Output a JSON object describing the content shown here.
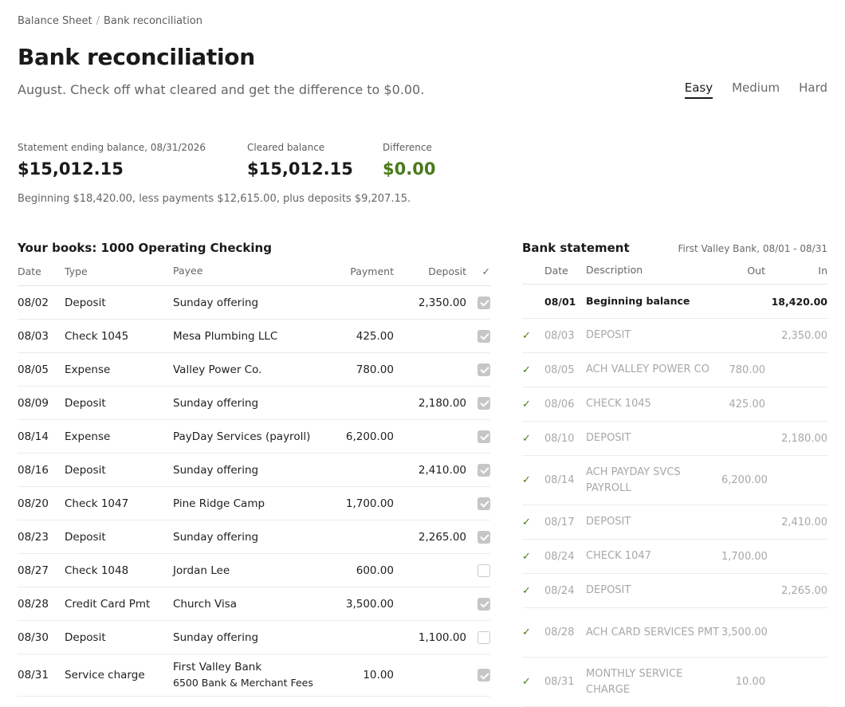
{
  "breadcrumb": {
    "parent": "Balance Sheet",
    "separator": "/",
    "current": "Bank reconciliation"
  },
  "page": {
    "title": "Bank reconciliation",
    "subtitle": "August. Check off what cleared and get the difference to $0.00."
  },
  "difficulty": {
    "options": [
      "Easy",
      "Medium",
      "Hard"
    ],
    "selected": "Easy"
  },
  "summary": {
    "statement_label": "Statement ending balance, 08/31/2026",
    "statement_value": "$15,012.15",
    "cleared_label": "Cleared balance",
    "cleared_value": "$15,012.15",
    "difference_label": "Difference",
    "difference_value": "$0.00",
    "difference_color": "#4a7a1a",
    "note": "Beginning $18,420.00, less payments $12,615.00, plus deposits $9,207.15."
  },
  "books": {
    "title": "Your books: 1000 Operating Checking",
    "columns": {
      "date": "Date",
      "type": "Type",
      "payee": "Payee",
      "payment": "Payment",
      "deposit": "Deposit",
      "cleared": "✓"
    },
    "rows": [
      {
        "date": "08/02",
        "type": "Deposit",
        "payee": "Sunday offering",
        "payee_sub": "",
        "payment": "",
        "deposit": "2,350.00",
        "cleared": true
      },
      {
        "date": "08/03",
        "type": "Check 1045",
        "payee": "Mesa Plumbing LLC",
        "payee_sub": "",
        "payment": "425.00",
        "deposit": "",
        "cleared": true
      },
      {
        "date": "08/05",
        "type": "Expense",
        "payee": "Valley Power Co.",
        "payee_sub": "",
        "payment": "780.00",
        "deposit": "",
        "cleared": true
      },
      {
        "date": "08/09",
        "type": "Deposit",
        "payee": "Sunday offering",
        "payee_sub": "",
        "payment": "",
        "deposit": "2,180.00",
        "cleared": true
      },
      {
        "date": "08/14",
        "type": "Expense",
        "payee": "PayDay Services (payroll)",
        "payee_sub": "",
        "payment": "6,200.00",
        "deposit": "",
        "cleared": true
      },
      {
        "date": "08/16",
        "type": "Deposit",
        "payee": "Sunday offering",
        "payee_sub": "",
        "payment": "",
        "deposit": "2,410.00",
        "cleared": true
      },
      {
        "date": "08/20",
        "type": "Check 1047",
        "payee": "Pine Ridge Camp",
        "payee_sub": "",
        "payment": "1,700.00",
        "deposit": "",
        "cleared": true
      },
      {
        "date": "08/23",
        "type": "Deposit",
        "payee": "Sunday offering",
        "payee_sub": "",
        "payment": "",
        "deposit": "2,265.00",
        "cleared": true
      },
      {
        "date": "08/27",
        "type": "Check 1048",
        "payee": "Jordan Lee",
        "payee_sub": "",
        "payment": "600.00",
        "deposit": "",
        "cleared": false
      },
      {
        "date": "08/28",
        "type": "Credit Card Pmt",
        "payee": "Church Visa",
        "payee_sub": "",
        "payment": "3,500.00",
        "deposit": "",
        "cleared": true
      },
      {
        "date": "08/30",
        "type": "Deposit",
        "payee": "Sunday offering",
        "payee_sub": "",
        "payment": "",
        "deposit": "1,100.00",
        "cleared": false
      },
      {
        "date": "08/31",
        "type": "Service charge",
        "payee": "First Valley Bank",
        "payee_sub": "6500 Bank & Merchant Fees",
        "payment": "10.00",
        "deposit": "",
        "cleared": true
      }
    ]
  },
  "bank": {
    "title": "Bank statement",
    "subtitle": "First Valley Bank, 08/01 - 08/31",
    "columns": {
      "date": "Date",
      "description": "Description",
      "out": "Out",
      "in": "In"
    },
    "rows": [
      {
        "matched": false,
        "date": "08/01",
        "description": "Beginning balance",
        "out": "",
        "in": "18,420.00",
        "beginning": true
      },
      {
        "matched": true,
        "date": "08/03",
        "description": "DEPOSIT",
        "out": "",
        "in": "2,350.00"
      },
      {
        "matched": true,
        "date": "08/05",
        "description": "ACH VALLEY POWER CO",
        "out": "780.00",
        "in": ""
      },
      {
        "matched": true,
        "date": "08/06",
        "description": "CHECK 1045",
        "out": "425.00",
        "in": ""
      },
      {
        "matched": true,
        "date": "08/10",
        "description": "DEPOSIT",
        "out": "",
        "in": "2,180.00"
      },
      {
        "matched": true,
        "date": "08/14",
        "description": "ACH PAYDAY SVCS PAYROLL",
        "out": "6,200.00",
        "in": ""
      },
      {
        "matched": true,
        "date": "08/17",
        "description": "DEPOSIT",
        "out": "",
        "in": "2,410.00"
      },
      {
        "matched": true,
        "date": "08/24",
        "description": "CHECK 1047",
        "out": "1,700.00",
        "in": ""
      },
      {
        "matched": true,
        "date": "08/24",
        "description": "DEPOSIT",
        "out": "",
        "in": "2,265.00"
      },
      {
        "matched": true,
        "date": "08/28",
        "description": "ACH CARD SERVICES PMT",
        "out": "3,500.00",
        "in": ""
      },
      {
        "matched": true,
        "date": "08/31",
        "description": "MONTHLY SERVICE CHARGE",
        "out": "10.00",
        "in": ""
      }
    ],
    "tick_glyph": "✓"
  }
}
